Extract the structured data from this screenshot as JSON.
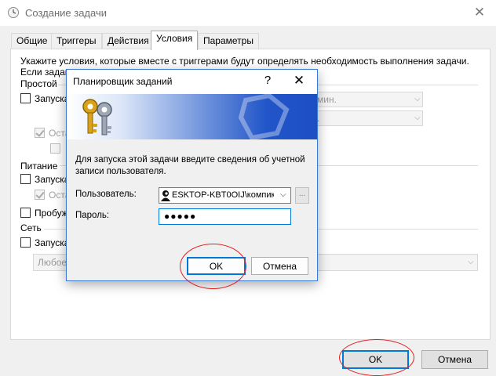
{
  "main": {
    "title": "Создание задачи",
    "close_glyph": "✕",
    "tabs": [
      {
        "label": "Общие"
      },
      {
        "label": "Триггеры"
      },
      {
        "label": "Действия"
      },
      {
        "label": "Условия"
      },
      {
        "label": "Параметры"
      }
    ],
    "active_tab": "Условия",
    "panel": {
      "intro": "Укажите условия, которые вместе с триггерами будут определять необходимость выполнения задачи.",
      "intro2_fragment": "Если задан",
      "idle_group": "Простой",
      "idle_check": "Запуска",
      "idle_minutes_value": "мин.",
      "idle_stop_fragment": "Оста",
      "power_group": "Питание",
      "power_check": "Запуска",
      "power_stop_fragment": "Оста",
      "wake_check": "Пробуж",
      "network_group": "Сеть",
      "network_check": "Запуска",
      "network_select_value": "Любое"
    },
    "ok_label": "OK",
    "cancel_label": "Отмена"
  },
  "dialog": {
    "title": "Планировщик заданий",
    "help_glyph": "?",
    "close_glyph": "✕",
    "info": "Для запуска этой задачи введите сведения об учетной записи пользователя.",
    "user_label": "Пользователь:",
    "user_value": "ESKTOP-KBT0OIJ\\компик",
    "password_label": "Пароль:",
    "password_value": "●●●●●",
    "ok_label": "OK",
    "cancel_label": "Отмена",
    "browse_glyph": "..."
  },
  "colors": {
    "accent": "#0078d7",
    "annotation": "#e01f1f",
    "banner_blue": "#1d4fc3"
  }
}
